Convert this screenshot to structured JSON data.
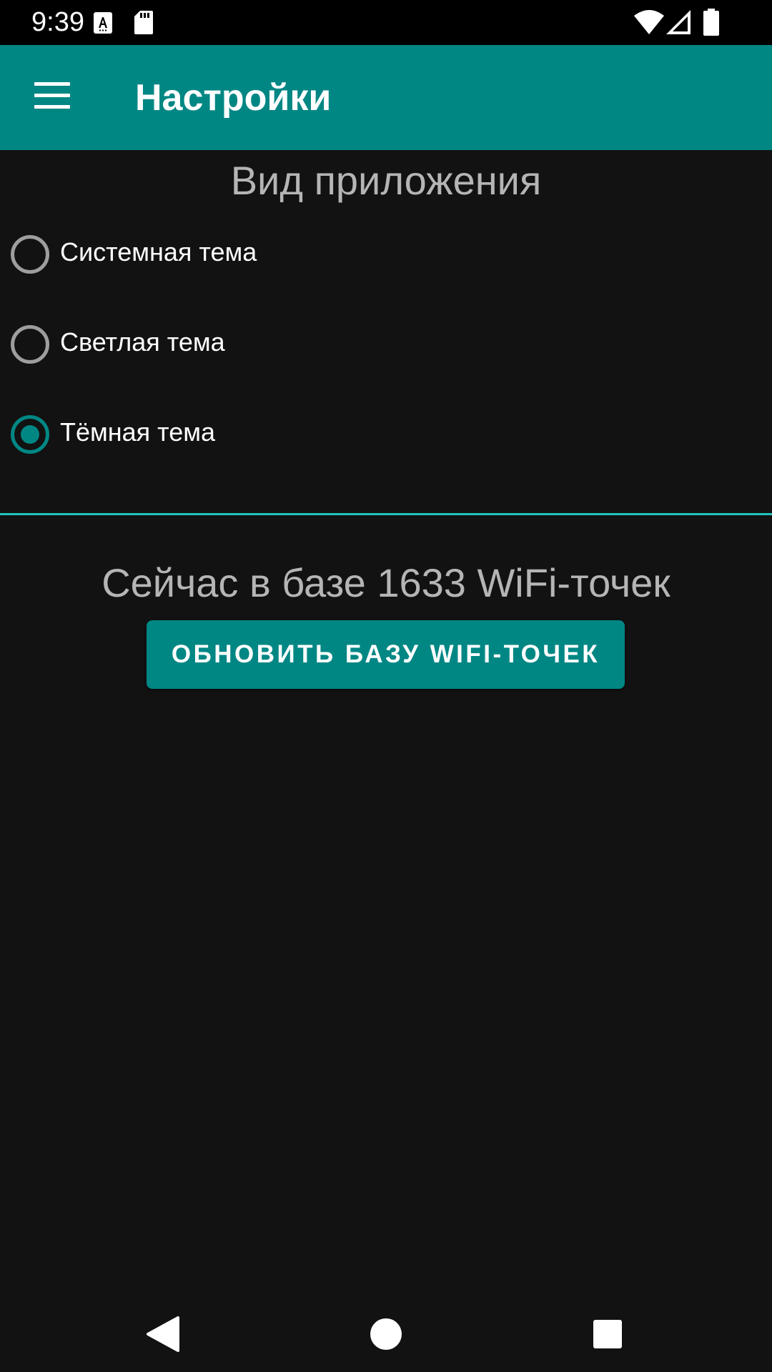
{
  "status_bar": {
    "time": "9:39",
    "icons": [
      "a11y-notification-icon",
      "sd-card-icon",
      "wifi-icon",
      "cell-signal-icon",
      "battery-icon"
    ]
  },
  "app_bar": {
    "title": "Настройки",
    "menu_icon": "hamburger-menu-icon"
  },
  "appearance": {
    "heading": "Вид приложения",
    "options": [
      {
        "label": "Системная тема",
        "checked": false
      },
      {
        "label": "Светлая тема",
        "checked": false
      },
      {
        "label": "Тёмная тема",
        "checked": true
      }
    ]
  },
  "database": {
    "count_text": "Сейчас в базе 1633 WiFi-точек",
    "update_button_label": "ОБНОВИТЬ БАЗУ WIFI-ТОЧЕК"
  },
  "nav_bar": {
    "back_icon": "back-triangle-icon",
    "home_icon": "home-circle-icon",
    "recents_icon": "recents-square-icon"
  },
  "colors": {
    "accent": "#008784",
    "background": "#121212",
    "divider": "#1fc5c0",
    "secondary_text": "#b5b5b5"
  }
}
